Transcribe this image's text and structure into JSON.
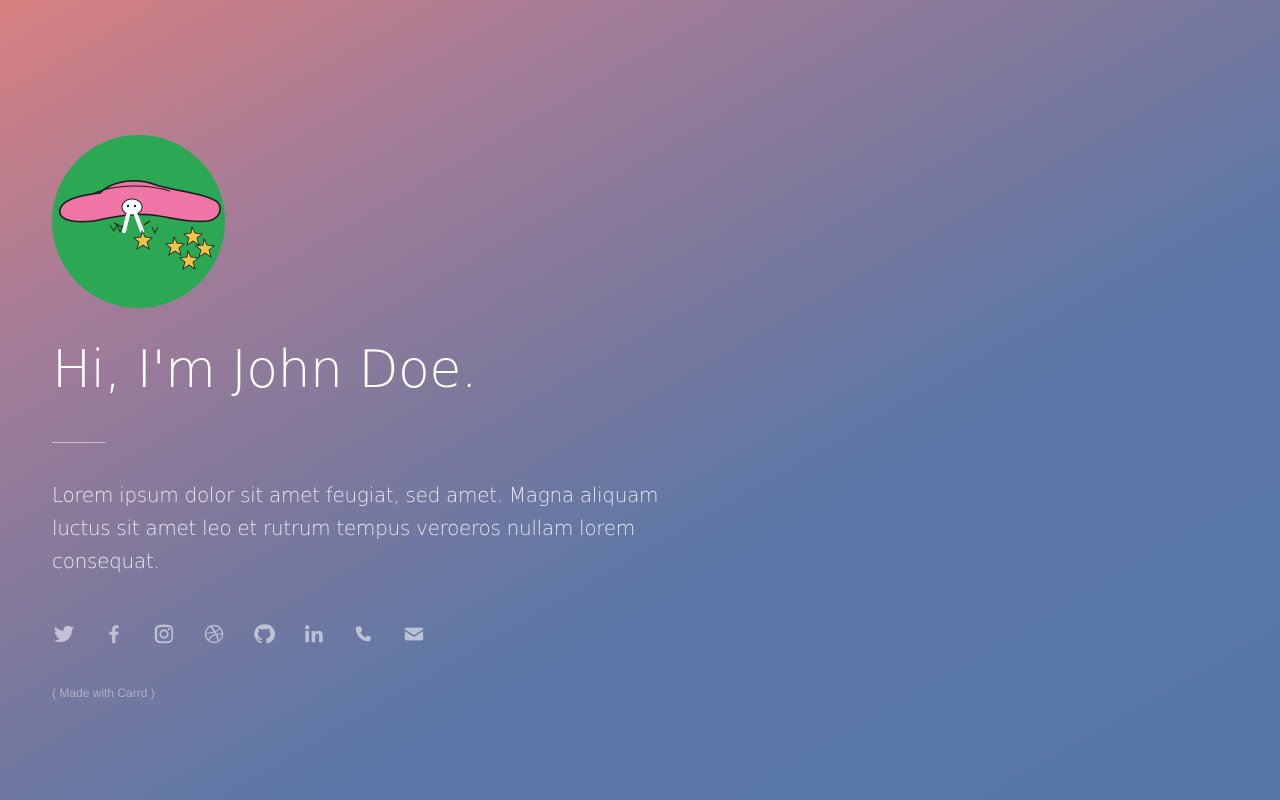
{
  "profile": {
    "avatar_icon": "mushroom-illustration",
    "avatar_bg": "#2ca754",
    "title": "Hi, I'm John Doe.",
    "bio": "Lorem ipsum dolor sit amet feugiat, sed amet. Magna aliquam luctus sit amet leo et rutrum tempus veroeros nullam lorem consequat."
  },
  "socials": [
    {
      "icon": "twitter-icon"
    },
    {
      "icon": "facebook-icon"
    },
    {
      "icon": "instagram-icon"
    },
    {
      "icon": "dribbble-icon"
    },
    {
      "icon": "github-icon"
    },
    {
      "icon": "linkedin-icon"
    },
    {
      "icon": "phone-icon"
    },
    {
      "icon": "envelope-icon"
    }
  ],
  "footer": {
    "credit_open": "( ",
    "credit_link": "Made with Carrd",
    "credit_close": " )"
  },
  "colors": {
    "gradient_start": "#d88080",
    "gradient_end": "#5575a9",
    "icon": "rgba(255,255,255,0.55)"
  }
}
